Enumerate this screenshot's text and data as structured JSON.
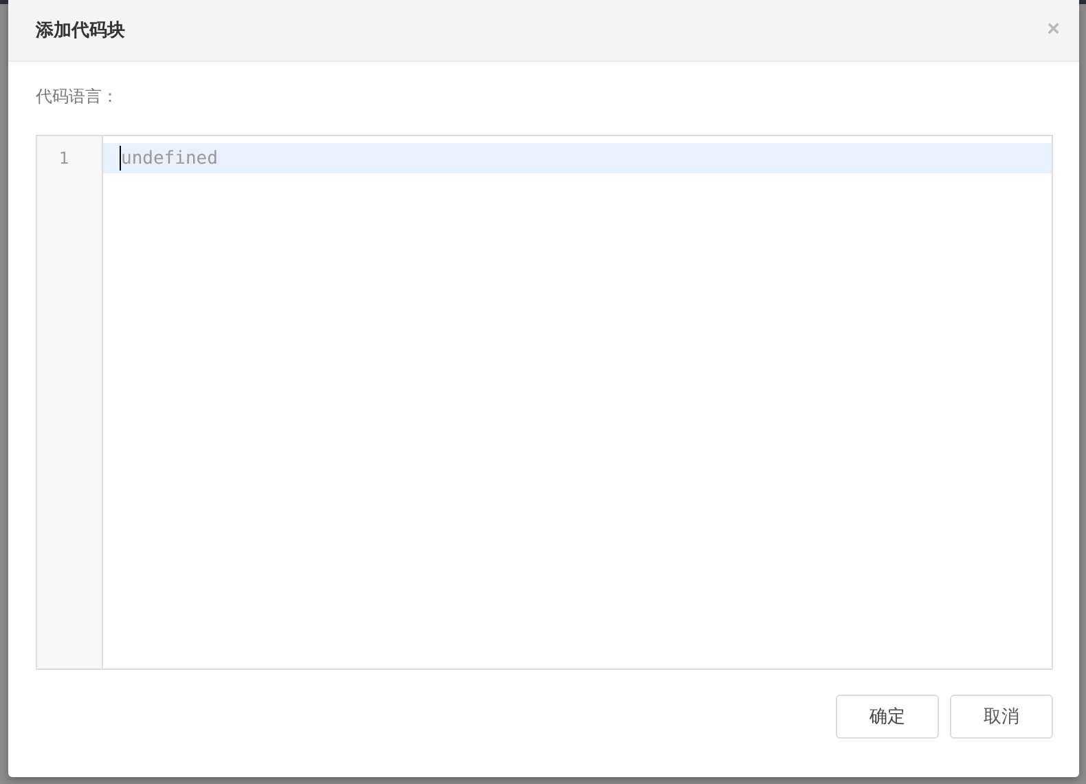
{
  "dialog": {
    "title": "添加代码块",
    "close": "×",
    "field_label": "代码语言：",
    "editor": {
      "lines": [
        {
          "number": "1",
          "text": "undefined",
          "active": true
        }
      ]
    },
    "buttons": [
      {
        "label": "确定",
        "kind": "primary"
      },
      {
        "label": "取消",
        "kind": "cancel"
      }
    ]
  }
}
